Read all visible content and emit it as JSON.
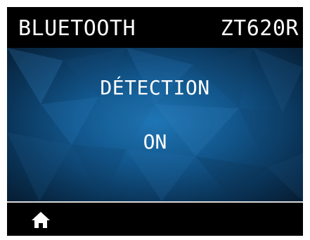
{
  "header": {
    "section": "BLUETOOTH",
    "model": "ZT620R"
  },
  "setting": {
    "name": "DÉTECTION",
    "value": "ON"
  },
  "footer": {
    "home_icon": "home-icon"
  },
  "colors": {
    "screen_background": "#000000",
    "panel_blue": "#12578d",
    "text": "#ffffff",
    "divider": "#d9d9d9"
  }
}
